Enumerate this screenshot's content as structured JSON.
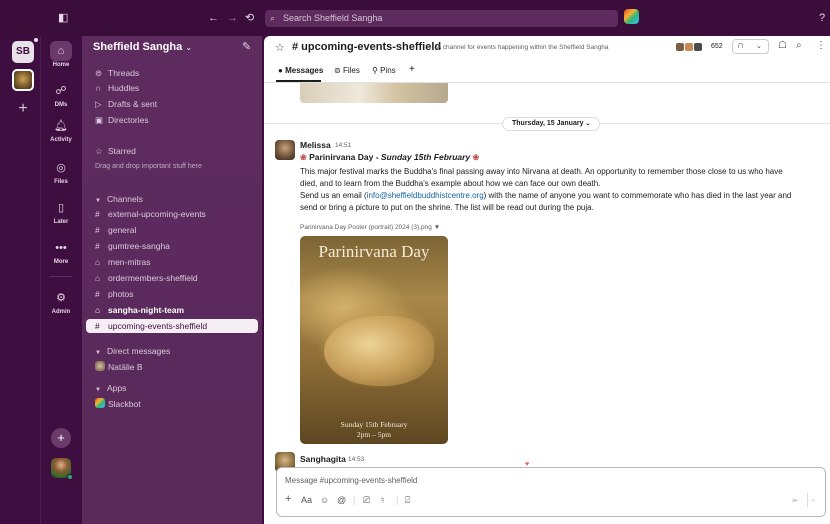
{
  "topbar": {
    "search_placeholder": "Search Sheffield Sangha"
  },
  "workspace": {
    "initials": "SB"
  },
  "rail": [
    {
      "label": "Home",
      "icon": "home-icon"
    },
    {
      "label": "DMs",
      "icon": "dms-icon"
    },
    {
      "label": "Activity",
      "icon": "bell-icon"
    },
    {
      "label": "Files",
      "icon": "files-icon"
    },
    {
      "label": "Later",
      "icon": "bookmark-icon"
    },
    {
      "label": "More",
      "icon": "more-icon"
    },
    {
      "label": "Admin",
      "icon": "gear-icon"
    }
  ],
  "sidebar": {
    "workspace_name": "Sheffield Sangha",
    "top_items": [
      {
        "label": "Threads",
        "icon": "threads-icon"
      },
      {
        "label": "Huddles",
        "icon": "headphones-icon"
      },
      {
        "label": "Drafts & sent",
        "icon": "send-icon"
      },
      {
        "label": "Directories",
        "icon": "directory-icon"
      }
    ],
    "starred_label": "Starred",
    "starred_hint": "Drag and drop important stuff here",
    "channels_label": "Channels",
    "channels": [
      {
        "name": "external-upcoming-events",
        "prefix": "#",
        "bold": false
      },
      {
        "name": "general",
        "prefix": "#",
        "bold": false
      },
      {
        "name": "gumtree-sangha",
        "prefix": "#",
        "bold": false
      },
      {
        "name": "men-mitras",
        "prefix": "lock",
        "bold": false
      },
      {
        "name": "ordermembers-sheffield",
        "prefix": "lock",
        "bold": false
      },
      {
        "name": "photos",
        "prefix": "#",
        "bold": false
      },
      {
        "name": "sangha-night-team",
        "prefix": "lock",
        "bold": true
      },
      {
        "name": "upcoming-events-sheffield",
        "prefix": "#",
        "bold": false,
        "selected": true
      }
    ],
    "dm_label": "Direct messages",
    "dms": [
      {
        "name": "Natālie B"
      }
    ],
    "apps_label": "Apps",
    "apps": [
      {
        "name": "Slackbot"
      }
    ]
  },
  "channel": {
    "name": "# upcoming-events-sheffield",
    "description": "A channel for events happening within the Sheffield Sangha",
    "member_count": "652",
    "tabs": [
      "Messages",
      "Files",
      "Pins"
    ]
  },
  "messages": {
    "day_divider": "Thursday, 15 January",
    "first": {
      "author": "Melissa",
      "time": "14:51",
      "title_prefix": "Parinirvana Day - ",
      "title_italic": "Sunday 15th February",
      "line1": "This major festival marks the Buddha's final passing away into Nirvana at death. An opportunity to remember those close to us who have",
      "line2": "died, and to learn from the Buddha's example about how we can face our own death.",
      "line3_pre": "Send us an email (",
      "line3_link": "info@sheffieldbuddhistcentre.org",
      "line3_post": ") with the name of anyone you want to commemorate who has died in the last year and",
      "line4": "send or bring a picture to put on the shrine. The list will be read out during the puja.",
      "file_name": "Parinirvana Day Poster (portrait) 2024 (3).png",
      "poster_title": "Parinirvana Day",
      "poster_date": "Sunday 15th February",
      "poster_time": "2pm – 5pm"
    },
    "second": {
      "author": "Sanghagita",
      "time": "14:53"
    }
  },
  "composer": {
    "placeholder": "Message #upcoming-events-sheffield"
  }
}
